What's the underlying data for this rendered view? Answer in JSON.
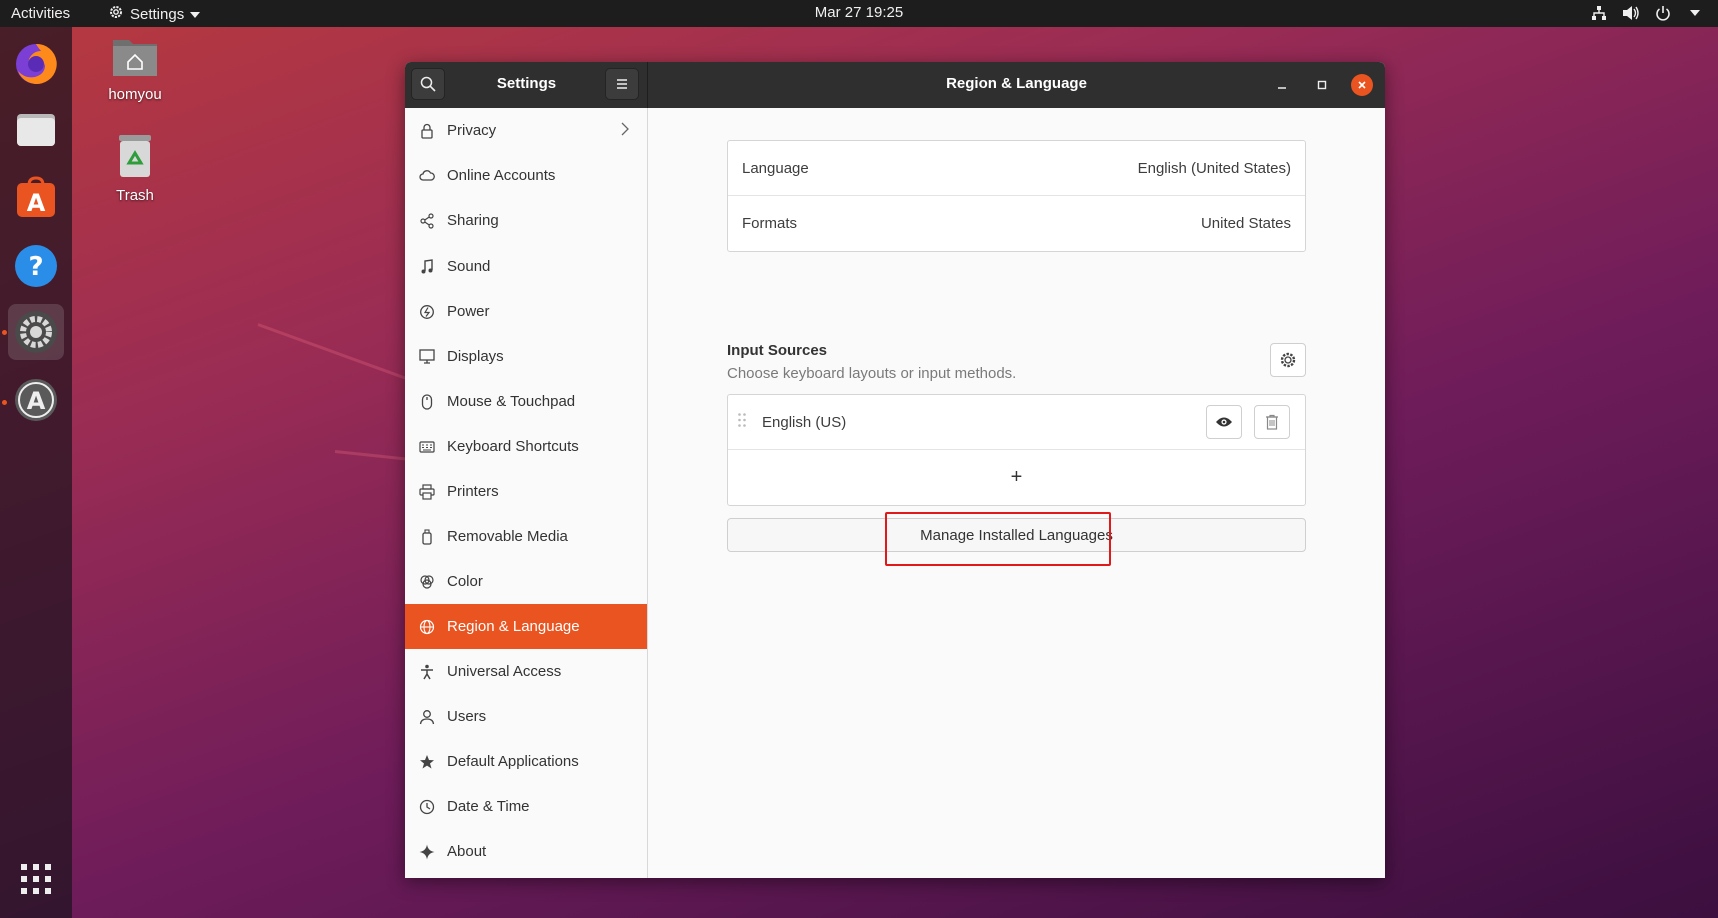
{
  "topbar": {
    "activities": "Activities",
    "app_menu": "Settings",
    "clock": "Mar 27  19:25"
  },
  "desktop": {
    "home_label": "homyou",
    "trash_label": "Trash"
  },
  "window": {
    "sidebar_title": "Settings",
    "main_title": "Region & Language"
  },
  "sidebar": {
    "items": [
      {
        "label": "Privacy",
        "icon": "lock-icon"
      },
      {
        "label": "Online Accounts",
        "icon": "cloud-icon"
      },
      {
        "label": "Sharing",
        "icon": "share-icon"
      },
      {
        "label": "Sound",
        "icon": "music-note-icon"
      },
      {
        "label": "Power",
        "icon": "power-icon"
      },
      {
        "label": "Displays",
        "icon": "display-icon"
      },
      {
        "label": "Mouse & Touchpad",
        "icon": "mouse-icon"
      },
      {
        "label": "Keyboard Shortcuts",
        "icon": "keyboard-icon"
      },
      {
        "label": "Printers",
        "icon": "printer-icon"
      },
      {
        "label": "Removable Media",
        "icon": "usb-icon"
      },
      {
        "label": "Color",
        "icon": "color-icon"
      },
      {
        "label": "Region & Language",
        "icon": "globe-icon"
      },
      {
        "label": "Universal Access",
        "icon": "accessibility-icon"
      },
      {
        "label": "Users",
        "icon": "user-icon"
      },
      {
        "label": "Default Applications",
        "icon": "star-icon"
      },
      {
        "label": "Date & Time",
        "icon": "clock-icon"
      },
      {
        "label": "About",
        "icon": "sparkle-icon"
      }
    ],
    "selected": "Region & Language"
  },
  "region": {
    "language_label": "Language",
    "language_value": "English (United States)",
    "formats_label": "Formats",
    "formats_value": "United States",
    "input_sources_title": "Input Sources",
    "input_sources_subtitle": "Choose keyboard layouts or input methods.",
    "input_source": "English (US)",
    "add_symbol": "+",
    "manage_button": "Manage Installed Languages"
  },
  "colors": {
    "accent": "#e95420",
    "highlight": "#e0191b"
  }
}
